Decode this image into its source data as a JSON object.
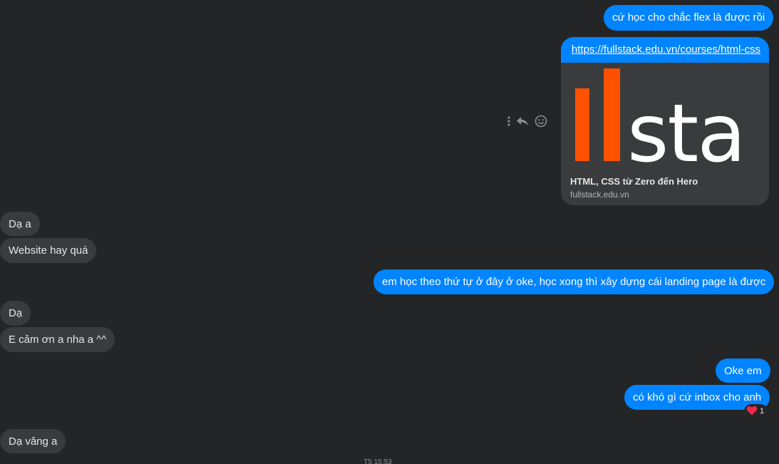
{
  "messages": {
    "m1": "cứ học cho chắc flex là được rồi",
    "m2": "Dạ a",
    "m3": "Website hay quá",
    "m4": "em học theo thứ tự ở đây ở oke, học xong thì xây dựng cái landing page là được",
    "m5": "Dạ",
    "m6": "E cảm ơn a nha a ^^",
    "m7": "Oke em",
    "m8": "có khó gì cứ inbox cho anh",
    "m9": "Dạ vâng a"
  },
  "link_preview": {
    "url": "https://fullstack.edu.vn/courses/html-css",
    "logo_text": "sta",
    "title": "HTML, CSS từ Zero đến Hero",
    "domain": "fullstack.edu.vn"
  },
  "message_actions": [
    "more-icon",
    "reply-icon",
    "react-icon"
  ],
  "reaction": {
    "icon": "heart-icon",
    "count": "1"
  },
  "timestamp": "T5 15:53",
  "colors": {
    "background": "#242526",
    "outgoing_bubble": "#0084ff",
    "incoming_bubble": "#3a3b3c",
    "logo_accent": "#ff5100"
  }
}
